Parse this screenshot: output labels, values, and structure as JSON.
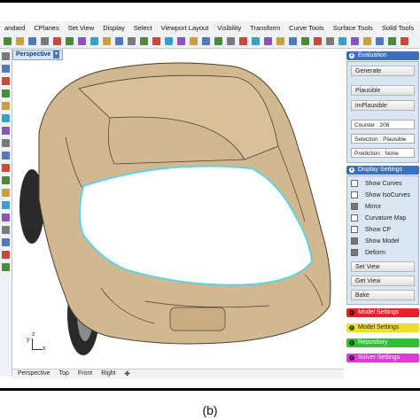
{
  "menu": [
    "andard",
    "CPlanes",
    "Set View",
    "Display",
    "Select",
    "Viewport Layout",
    "Visibility",
    "Transform",
    "Curve Tools",
    "Surface Tools",
    "Solid Tools"
  ],
  "viewport": {
    "active_tab": "Perspective"
  },
  "axes": {
    "y": "y",
    "z": "z",
    "x": "x"
  },
  "view_tabs": [
    "Perspective",
    "Top",
    "Front",
    "Right",
    "✤"
  ],
  "panel": {
    "evaluation": {
      "title": "Evaluation",
      "generate": "Generate",
      "plausible": "Plausible",
      "implausible": "imPlausible",
      "counter": "Counter :  206",
      "selection": "Selection :  Plausible",
      "prediction": "Prediction :  None"
    },
    "display": {
      "title": "Display Settings",
      "items": [
        {
          "label": "Show Curves",
          "checked": false
        },
        {
          "label": "Show IsoCurves",
          "checked": false
        },
        {
          "label": "Mirror",
          "checked": true
        },
        {
          "label": "Curvature Map",
          "checked": false
        },
        {
          "label": "Show CP",
          "checked": false
        },
        {
          "label": "Show Model",
          "checked": true
        },
        {
          "label": "Deform",
          "checked": true
        }
      ],
      "set_view": "Set View",
      "get_view": "Get View",
      "bake": "Bake"
    },
    "sections": [
      {
        "label": "Model Settings",
        "color": "#e8202a"
      },
      {
        "label": "Model Settings",
        "color": "#f0e020"
      },
      {
        "label": "Repository",
        "color": "#2fbf2f"
      },
      {
        "label": "Solver Settings",
        "color": "#e03ad8"
      }
    ]
  },
  "caption": "(b)",
  "colors": {
    "accent": "#3a6fc4",
    "car_body": "#d2b890",
    "hood": "#ffffff",
    "hood_outline": "#5fd3e0"
  }
}
